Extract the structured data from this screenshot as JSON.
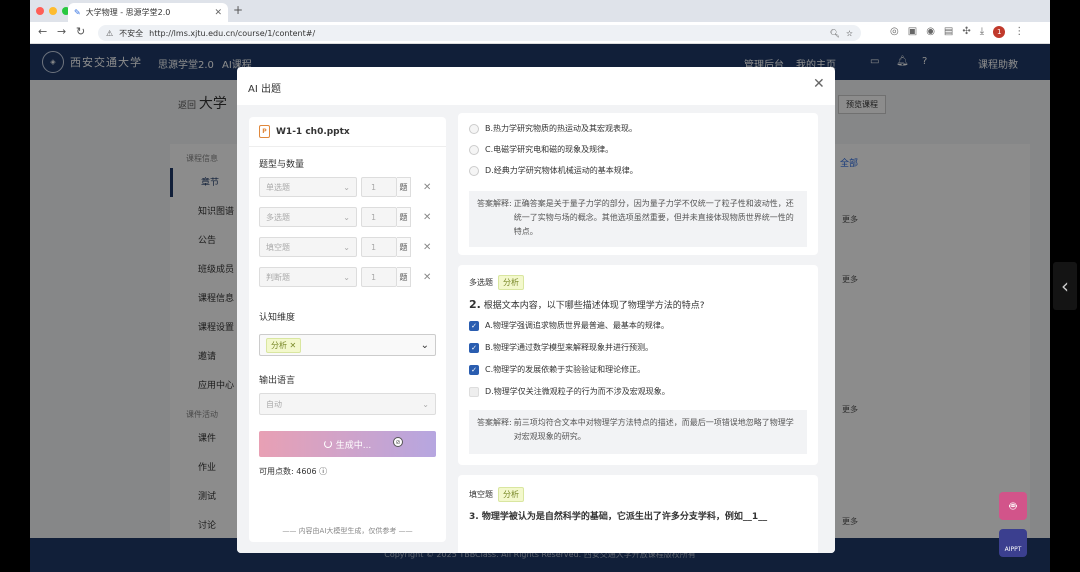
{
  "browser": {
    "tab_title": "大学物理 - 思源学堂2.0",
    "insecure_label": "不安全",
    "url": "http://lms.xjtu.edu.cn/course/1/content#/",
    "profile_initial": "1"
  },
  "site": {
    "logo_text": "西安交通大学",
    "nav": [
      "思源学堂2.0",
      "AI课程"
    ],
    "nav_right": [
      "管理后台",
      "我的主页",
      "课程助教"
    ],
    "notif_count": "1",
    "course_back": "返回",
    "course_title": "大学",
    "preview_label": "预览课程",
    "footer": "Copyright © 2025 TBBClass. All Rights Reserved. 西安交通大学开放课程版权所有"
  },
  "sidemenu": {
    "group1": "课程信息",
    "items1": [
      "章节",
      "知识图谱",
      "公告",
      "班级成员",
      "课程信息",
      "课程设置",
      "邀请",
      "应用中心"
    ],
    "group2": "课件活动",
    "items2": [
      "课件",
      "作业",
      "测试",
      "讨论"
    ]
  },
  "rightpane": {
    "all_label": "全部",
    "more_label": "更多"
  },
  "modal": {
    "title": "AI 出题",
    "file_name": "W1-1 ch0.pptx",
    "section_types": "题型与数量",
    "types": [
      {
        "label": "单选题",
        "count": "1",
        "unit": "题"
      },
      {
        "label": "多选题",
        "count": "1",
        "unit": "题"
      },
      {
        "label": "填空题",
        "count": "1",
        "unit": "题"
      },
      {
        "label": "判断题",
        "count": "1",
        "unit": "题"
      }
    ],
    "section_dimension": "认知维度",
    "dimension_tag": "分析",
    "section_language": "输出语言",
    "language_value": "自动",
    "generate_label": "生成中...",
    "points_label": "可用点数: 4606",
    "footer_note": "内容由AI大模型生成，仅供参考",
    "q1": {
      "options": [
        "B.热力学研究物质的热运动及其宏观表现。",
        "C.电磁学研究电和磁的现象及规律。",
        "D.经典力学研究物体机械运动的基本规律。"
      ],
      "explanation_key": "答案解释:",
      "explanation": "正确答案是关于量子力学的部分，因为量子力学不仅统一了粒子性和波动性，还统一了实物与场的概念。其他选项虽然重要，但并未直接体现物质世界统一性的特点。"
    },
    "q2": {
      "type": "多选题",
      "tag": "分析",
      "number": "2.",
      "stem": "根据文本内容，以下哪些描述体现了物理学方法的特点?",
      "options": [
        {
          "text": "A.物理学强调追求物质世界最普遍、最基本的规律。",
          "checked": true
        },
        {
          "text": "B.物理学通过数学模型来解释现象并进行预测。",
          "checked": true
        },
        {
          "text": "C.物理学的发展依赖于实验验证和理论修正。",
          "checked": true
        },
        {
          "text": "D.物理学仅关注微观粒子的行为而不涉及宏观现象。",
          "checked": false
        }
      ],
      "explanation_key": "答案解释:",
      "explanation": "前三项均符合文本中对物理学方法特点的描述，而最后一项错误地忽略了物理学对宏观现象的研究。"
    },
    "q3": {
      "type": "填空题",
      "tag": "分析",
      "stem": "3. 物理学被认为是自然科学的基础，它派生出了许多分支学科，例如__1__"
    }
  },
  "widgets": {
    "aippt_label": "AIPPT"
  },
  "colors": {
    "nav_bg": "#1f3a68",
    "check_blue": "#2a5db0",
    "tag_bg": "#f3f8cc"
  }
}
